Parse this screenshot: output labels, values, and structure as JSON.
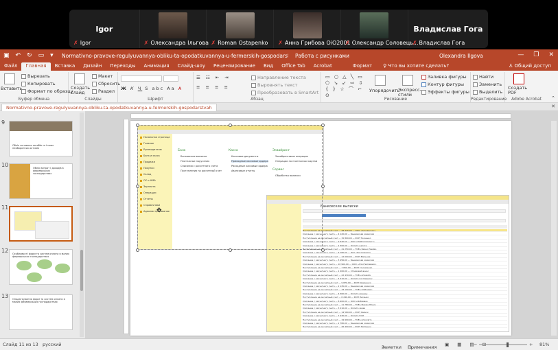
{
  "participants": [
    {
      "name_big": "Igor",
      "caption": "Igor"
    },
    {
      "caption": "Олександра Ільгова"
    },
    {
      "caption": "Roman Ostapenko"
    },
    {
      "caption": "Анна Грибова ОіО2001"
    },
    {
      "caption": "Олександр Соловець..."
    },
    {
      "name_big": "Владислав Гога",
      "caption": "Владислав Гога"
    }
  ],
  "window": {
    "title": "Normativno-pravove-regulyuvannya-obliku-ta-opodatkuvannya-u-fermerskih-gospodarstvah - PowerPoint (Сбой акт...",
    "context": "Работа с рисунками",
    "user": "Olexandra Ilgova",
    "controls": [
      "—",
      "❐",
      "✕"
    ]
  },
  "tabs": [
    "Файл",
    "Главная",
    "Вставка",
    "Дизайн",
    "Переходы",
    "Анимация",
    "Слайд-шоу",
    "Рецензирование",
    "Вид",
    "Office Tab",
    "Acrobat",
    "Формат"
  ],
  "tell_me": "Что вы хотите сделать?",
  "share": "Общий доступ",
  "ribbon": {
    "clipboard": {
      "paste": "Вставить",
      "cut": "Вырезать",
      "copy": "Копировать",
      "format_painter": "Формат по образцу",
      "label": "Буфер обмена"
    },
    "slides": {
      "new_slide": "Создать слайд",
      "layout": "Макет",
      "reset": "Сбросить",
      "section": "Раздел",
      "label": "Слайды"
    },
    "font": {
      "label": "Шрифт",
      "buttons": [
        "Ж",
        "К",
        "Ч",
        "S",
        "abc",
        "Aa",
        "A"
      ]
    },
    "paragraph": {
      "direction": "Направление текста",
      "align": "Выровнять текст",
      "smartart": "Преобразовать в SmartArt",
      "label": "Абзац"
    },
    "drawing": {
      "arrange": "Упорядочить",
      "quick_styles": "Экспресс-стили",
      "fill": "Заливка фигуры",
      "outline": "Контур фигуры",
      "effects": "Эффекты фигуры",
      "label": "Рисование"
    },
    "editing": {
      "find": "Найти",
      "replace": "Заменить",
      "select": "Выделить",
      "label": "Редактирование"
    },
    "acrobat": {
      "create_pdf": "Создать PDF",
      "label": "Adobe Acrobat"
    }
  },
  "document_tab": "Normativno-pravove-regulyuvannya-obliku-ta-opodatkuvannya-u-fermerskih-gospodarstvah",
  "thumbnails": [
    {
      "num": "9",
      "title": "Облік основних засобів та інших необоротних активів"
    },
    {
      "num": "10",
      "title": "Облік витрат і доходів в фермерських господарствах"
    },
    {
      "num": "11",
      "title": ""
    },
    {
      "num": "12",
      "title": "Особливості форм та систем оплати в малих фермерських господарствах"
    },
    {
      "num": "13",
      "title": "Оподаткування форм та систем оплати в малих фермерських господарствах"
    }
  ],
  "slide": {
    "shot1": {
      "sidebar": [
        "Начальная страница",
        "Главное",
        "Руководителю",
        "Банк и касса",
        "Продажи",
        "Покупки",
        "Склад",
        "ОС и НМА",
        "Зарплата",
        "Операции",
        "Отчеты",
        "Справочники",
        "Администрирование"
      ],
      "col1_head": "Банк",
      "col1": [
        "Банковские выписки",
        "Платежные поручения",
        "Списания с расчетного счета",
        "Поступления на расчетный счет"
      ],
      "col2_head": "Касса",
      "col2": [
        "Кассовые документы",
        "Приходные кассовые ордера",
        "Расходные кассовые ордера",
        "Авансовые отчеты"
      ],
      "col3_head": "Эквайринг",
      "col3": [
        "Эквайринговые операции",
        "Операции по платежным картам"
      ],
      "col4_head": "Сервис",
      "col4": [
        "Обработка выписки"
      ]
    },
    "shot2": {
      "title": "Банковские выписки",
      "rows": [
        "Поступление на расчетный счет — 28 345,00 — ООО «Агроресурс»",
        "Списание с расчетного счета — 4 120,00 — Банковская комиссия",
        "Поступление на расчетный счет — 15 800,00 — ФОП Ткаченко",
        "Списание с расчетного счета — 9 640,50 — ООО «Нафтопродукт»",
        "Списание с расчетного счета — 2 300,00 — Оплата налога",
        "Поступление на расчетный счет — 41 250,00 — ТОВ «Зерно-Трейд»",
        "Списание с расчетного счета — 6 780,00 — ПАТ «Укртелеком»",
        "Поступление на расчетный счет — 12 000,00 — ФОП Мельник",
        "Списание с расчетного счета — 3 456,00 — Банковская комиссия",
        "Списание с расчетного счета — 18 900,00 — ООО «АгроТехСервис»",
        "Поступление на расчетный счет — 7 650,00 — ФОП Гончаренко",
        "Списание с расчетного счета — 1 200,00 — Страховой взнос",
        "Поступление на расчетный счет — 22 430,00 — ТОВ «Аграрій»",
        "Списание с расчетного счета — 5 310,00 — Оплата поставщику",
        "Поступление на расчетный счет — 9 870,00 — ФОП Кравченко",
        "Списание с расчетного счета — 2 145,00 — Банковская комиссия",
        "Поступление на расчетный счет — 33 100,00 — ТОВ «Хлібодар»",
        "Списание с расчетного счета — 4 560,00 — Оплата аренды",
        "Поступление на расчетный счет — 6 240,00 — ФОП Лисенко",
        "Списание с расчетного счета — 8 900,00 — ООО «Добрива»",
        "Поступление на расчетный счет — 11 780,00 — ТОВ «Ферма Плюс»",
        "Списание с расчетного счета — 3 210,00 — Оплата связи",
        "Поступление на расчетный счет — 14 560,00 — ФОП Савчук",
        "Списание с расчетного счета — 7 430,00 — Оплата ГСМ",
        "Поступление на расчетный счет — 19 990,00 — ТОВ «Агросвіт»",
        "Списание с расчетного счета — 2 780,00 — Банковская комиссия",
        "Поступление на расчетный счет — 26 400,00 — ФОП Петренко"
      ]
    }
  },
  "status": {
    "slide": "Слайд 11 из 13",
    "lang": "русский",
    "notes": "Заметки",
    "comments": "Примечания",
    "zoom": "81%"
  },
  "colors": {
    "accent": "#b7472a",
    "sidebar": "#fbf4b8",
    "highlight": "#f7e58a"
  }
}
